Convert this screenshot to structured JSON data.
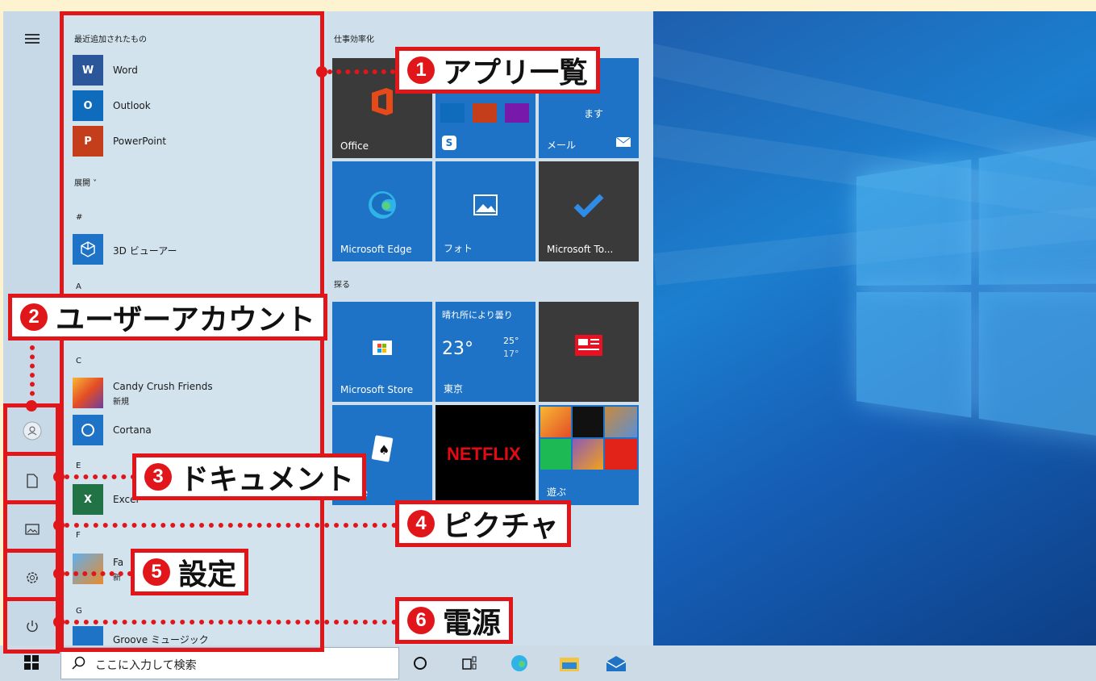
{
  "applist": {
    "recent_header": "最近追加されたもの",
    "recent": [
      {
        "label": "Word",
        "icon": "word-icon",
        "letter": "W",
        "color": "#2b579a"
      },
      {
        "label": "Outlook",
        "icon": "outlook-icon",
        "letter": "O",
        "color": "#0f6cbd"
      },
      {
        "label": "PowerPoint",
        "icon": "powerpoint-icon",
        "letter": "P",
        "color": "#c43e1c"
      }
    ],
    "expand": "展開 ˅",
    "hash_header": "#",
    "viewer3d": "3D ビューアー",
    "a_header": "A",
    "c_header": "C",
    "candy": "Candy Crush Friends",
    "candy_sub": "新規",
    "cortana": "Cortana",
    "e_header": "E",
    "excel": "Excel",
    "f_header": "F",
    "f_app": "Fa",
    "f_app_sub": "新",
    "g_header": "G",
    "g_app": "Groove ミュージック"
  },
  "tiles": {
    "group1": "仕事効率化",
    "group2": "探る",
    "office": "Office",
    "mail": "メール",
    "mail_text": "ます",
    "edge": "Microsoft Edge",
    "photos": "フォト",
    "todo": "Microsoft To...",
    "store": "Microsoft Store",
    "weather_title": "晴れ所により曇り",
    "weather_temp": "23°",
    "weather_high": "25°",
    "weather_low": "17°",
    "weather_city": "東京",
    "netflix": "NETFLIX",
    "solitaire": "litaire",
    "play": "遊ぶ"
  },
  "taskbar": {
    "search_placeholder": "ここに入力して検索"
  },
  "callouts": {
    "c1": {
      "num": "1",
      "text": "アプリ一覧"
    },
    "c2": {
      "num": "2",
      "text": "ユーザーアカウント"
    },
    "c3": {
      "num": "3",
      "text": "ドキュメント"
    },
    "c4": {
      "num": "4",
      "text": "ピクチャ"
    },
    "c5": {
      "num": "5",
      "text": "設定"
    },
    "c6": {
      "num": "6",
      "text": "電源"
    }
  },
  "colors": {
    "accent_red": "#e0161b",
    "tile_blue": "#1f73c6",
    "tile_dark": "#3a3a3a"
  }
}
